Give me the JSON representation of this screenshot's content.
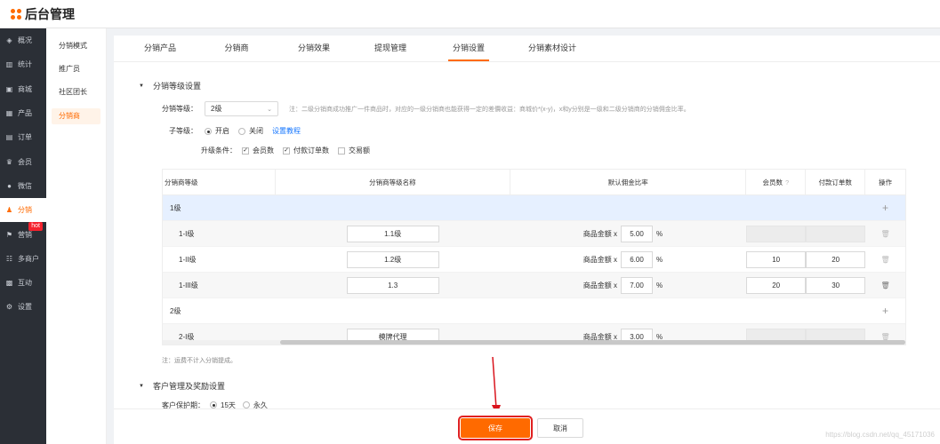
{
  "app": {
    "title": "后台管理"
  },
  "sidebar": {
    "items": [
      {
        "label": "概况",
        "icon": "dashboard-icon"
      },
      {
        "label": "统计",
        "icon": "chart-icon"
      },
      {
        "label": "商城",
        "icon": "store-icon"
      },
      {
        "label": "产品",
        "icon": "grid-icon"
      },
      {
        "label": "订单",
        "icon": "order-icon"
      },
      {
        "label": "会员",
        "icon": "crown-icon"
      },
      {
        "label": "微信",
        "icon": "wechat-icon"
      },
      {
        "label": "分销",
        "icon": "user-icon",
        "active": true
      },
      {
        "label": "营销",
        "icon": "flag-icon",
        "badge": "hot"
      },
      {
        "label": "多商户",
        "icon": "users-icon"
      },
      {
        "label": "互动",
        "icon": "interact-icon"
      },
      {
        "label": "设置",
        "icon": "gear-icon"
      }
    ]
  },
  "subsidebar": {
    "items": [
      {
        "label": "分销模式"
      },
      {
        "label": "推广员"
      },
      {
        "label": "社区团长"
      },
      {
        "label": "分销商",
        "active": true
      }
    ]
  },
  "tabs": [
    {
      "label": "分销产品"
    },
    {
      "label": "分销商"
    },
    {
      "label": "分销效果"
    },
    {
      "label": "提现管理"
    },
    {
      "label": "分销设置",
      "active": true
    },
    {
      "label": "分销素材设计"
    }
  ],
  "level_section": {
    "title": "分销等级设置",
    "level_label": "分销等级：",
    "level_value": "2级",
    "level_hint": "注：二级分销商成功推广一件商品时，对应的一级分销商也能获得一定的差價收益：商城价*(x-y)，x和y分别是一级和二级分销商的分销佣金比率。",
    "sub_label": "子等级：",
    "sub_on": "开启",
    "sub_off": "关闭",
    "sub_link": "设置教程",
    "cond_label": "升级条件：",
    "conditions": [
      {
        "label": "会员数",
        "checked": true
      },
      {
        "label": "付款订单数",
        "checked": true
      },
      {
        "label": "交易额",
        "checked": false
      }
    ]
  },
  "table": {
    "headers": [
      "分销商等级",
      "分销商等级名称",
      "默认佣金比率",
      "会员数",
      "付款订单数",
      "操作"
    ],
    "amount_label": "商品金额 x",
    "percent": "%",
    "rows": [
      {
        "type": "group",
        "level": "1级"
      },
      {
        "type": "row",
        "level": "1-I级",
        "name": "1.1级",
        "rate": "5.00",
        "members": "",
        "orders": "",
        "disabled": true
      },
      {
        "type": "row",
        "level": "1-II级",
        "name": "1.2级",
        "rate": "6.00",
        "members": "10",
        "orders": "20",
        "disabled": false
      },
      {
        "type": "row",
        "level": "1-III级",
        "name": "1.3",
        "rate": "7.00",
        "members": "20",
        "orders": "30",
        "disabled": false
      },
      {
        "type": "group",
        "level": "2级"
      },
      {
        "type": "row",
        "level": "2-I级",
        "name": "模牌代理",
        "rate": "3.00",
        "members": "",
        "orders": "",
        "disabled": true
      }
    ]
  },
  "note": "注：运费不计入分销提成。",
  "customer_section": {
    "title": "客户管理及奖励设置",
    "protect_label": "客户保护期：",
    "protect_opt1": "15天",
    "protect_opt2": "永久"
  },
  "footer": {
    "save": "保存",
    "cancel": "取消"
  },
  "watermark": "https://blog.csdn.net/qq_45171036",
  "colors": {
    "accent": "#ff6a00",
    "highlight_box": "#e02020",
    "sidebar_bg": "#2b2f36"
  }
}
